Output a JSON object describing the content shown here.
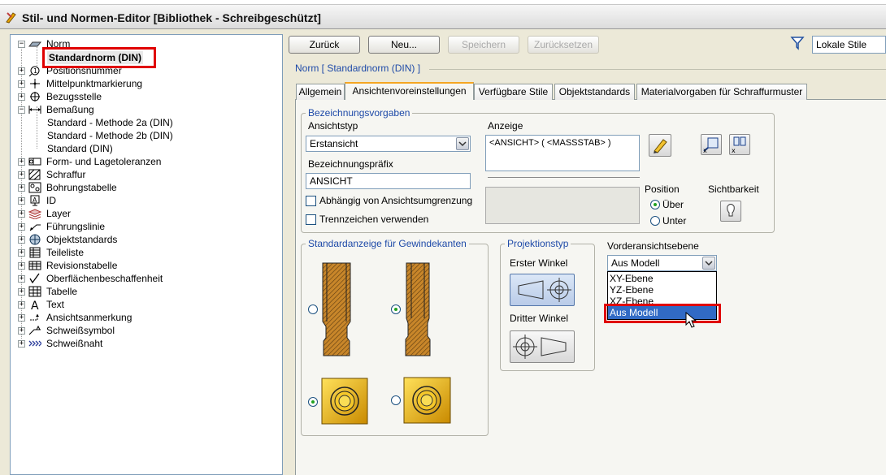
{
  "window": {
    "title": "Stil- und Normen-Editor [Bibliothek - Schreibgeschützt]"
  },
  "tree": {
    "items": [
      {
        "label": "Norm",
        "pm": "−"
      },
      {
        "label": "Standardnorm (DIN)",
        "pm": ""
      },
      {
        "label": "Positionsnummer",
        "pm": "+"
      },
      {
        "label": "Mittelpunktmarkierung",
        "pm": "+"
      },
      {
        "label": "Bezugsstelle",
        "pm": "+"
      },
      {
        "label": "Bemaßung",
        "pm": "−"
      },
      {
        "label": "Standard - Methode 2a (DIN)",
        "pm": ""
      },
      {
        "label": "Standard - Methode 2b (DIN)",
        "pm": ""
      },
      {
        "label": "Standard (DIN)",
        "pm": ""
      },
      {
        "label": "Form- und Lagetoleranzen",
        "pm": "+"
      },
      {
        "label": "Schraffur",
        "pm": "+"
      },
      {
        "label": "Bohrungstabelle",
        "pm": "+"
      },
      {
        "label": "ID",
        "pm": "+"
      },
      {
        "label": "Layer",
        "pm": "+"
      },
      {
        "label": "Führungslinie",
        "pm": "+"
      },
      {
        "label": "Objektstandards",
        "pm": "+"
      },
      {
        "label": "Teileliste",
        "pm": "+"
      },
      {
        "label": "Revisionstabelle",
        "pm": "+"
      },
      {
        "label": "Oberflächenbeschaffenheit",
        "pm": "+"
      },
      {
        "label": "Tabelle",
        "pm": "+"
      },
      {
        "label": "Text",
        "pm": "+"
      },
      {
        "label": "Ansichtsanmerkung",
        "pm": "+"
      },
      {
        "label": "Schweißsymbol",
        "pm": "+"
      },
      {
        "label": "Schweißnaht",
        "pm": "+"
      }
    ]
  },
  "toolbar": {
    "back": "Zurück",
    "new": "Neu...",
    "save": "Speichern",
    "reset": "Zurücksetzen",
    "filter_value": "Lokale Stile"
  },
  "breadcrumb": "Norm [ Standardnorm (DIN) ]",
  "tabs": [
    {
      "label": "Allgemein"
    },
    {
      "label": "Ansichtenvoreinstellungen"
    },
    {
      "label": "Verfügbare Stile"
    },
    {
      "label": "Objektstandards"
    },
    {
      "label": "Materialvorgaben für Schraffurmuster"
    }
  ],
  "naming": {
    "group_label": "Bezeichnungsvorgaben",
    "view_type_label": "Ansichtstyp",
    "view_type_value": "Erstansicht",
    "prefix_label": "Bezeichnungspräfix",
    "prefix_value": "ANSICHT",
    "display_label": "Anzeige",
    "display_value": "<ANSICHT> ( <MASSSTAB> )",
    "depends_label": "Abhängig von Ansichtsumgrenzung",
    "separator_label": "Trennzeichen verwenden",
    "position_label": "Position",
    "pos_above": "Über",
    "pos_below": "Unter",
    "visibility_label": "Sichtbarkeit"
  },
  "thread": {
    "group_label": "Standardanzeige für Gewindekanten"
  },
  "projection": {
    "group_label": "Projektionstyp",
    "first_angle": "Erster Winkel",
    "third_angle": "Dritter Winkel"
  },
  "front_plane": {
    "label": "Vorderansichtsebene",
    "value": "Aus Modell",
    "options": [
      "XY-Ebene",
      "YZ-Ebene",
      "XZ-Ebene",
      "Aus Modell"
    ]
  },
  "colors": {
    "highlight": "#e00000",
    "select": "#316ac5",
    "accent": "#1e4aa8"
  }
}
